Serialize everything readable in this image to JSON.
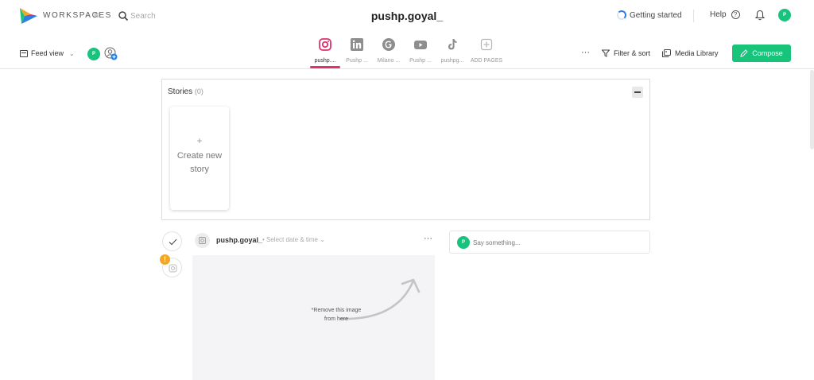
{
  "topbar": {
    "workspaces_label": "WORKSPACES",
    "menu_icon": "≡",
    "search": {
      "placeholder": "Search"
    },
    "title": "pushp.goyal_",
    "getting_started": "Getting started",
    "help": "Help",
    "help_icon": "?",
    "avatar_initial": "P"
  },
  "subbar": {
    "feed_view": "Feed view",
    "avatar_initial": "P",
    "channels": [
      {
        "label": "pushp....",
        "icon": "instagram-icon",
        "active": true
      },
      {
        "label": "Pushp ...",
        "icon": "linkedin-icon",
        "active": false
      },
      {
        "label": "Milano ...",
        "icon": "google-business-icon",
        "active": false
      },
      {
        "label": "Pushp ...",
        "icon": "youtube-icon",
        "active": false
      },
      {
        "label": "pushpg...",
        "icon": "tiktok-icon",
        "active": false
      },
      {
        "label": "ADD PAGES",
        "icon": "add-icon",
        "active": false
      }
    ],
    "more": "···",
    "filter_sort": "Filter & sort",
    "media_library": "Media Library",
    "compose": "Compose"
  },
  "stories": {
    "title": "Stories",
    "count": "(0)",
    "create_plus": "+",
    "create_label": "Create new story"
  },
  "post": {
    "account": "pushp.goyal_",
    "date_placeholder": "• Select date & time",
    "more": "···",
    "image_note": "*Remove this image from here",
    "warning": "!"
  },
  "comment": {
    "avatar_initial": "P",
    "placeholder": "Say something..."
  },
  "colors": {
    "accent_green": "#18c37a",
    "instagram_pink": "#e1306c",
    "warning_orange": "#f5a623"
  }
}
